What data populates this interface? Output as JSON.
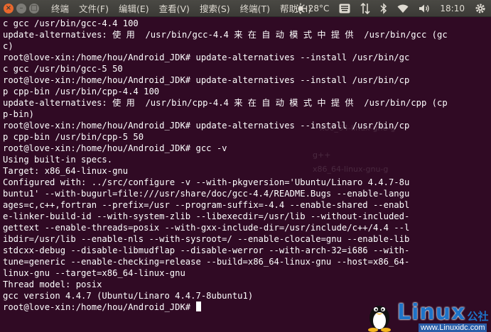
{
  "topbar": {
    "window_buttons": {
      "close": "×",
      "minimize": "–",
      "maximize": "□"
    },
    "menus": [
      "终端",
      "文件(F)",
      "编辑(E)",
      "查看(V)",
      "搜索(S)",
      "终端(T)",
      "帮助(H)"
    ],
    "indicators": {
      "weather": "28°C",
      "clock": "18:10",
      "icons": [
        "weather-sun-icon",
        "keyboard-layout-icon",
        "network-updown-icon",
        "bluetooth-icon",
        "wifi-icon",
        "volume-icon",
        "gear-icon"
      ]
    }
  },
  "terminal": {
    "lines": [
      "c gcc /usr/bin/gcc-4.4 100",
      "update-alternatives: 使 用  /usr/bin/gcc-4.4 来 在 自 动 模 式 中 提 供  /usr/bin/gcc (gc",
      "c)",
      "root@love-xin:/home/hou/Android_JDK# update-alternatives --install /usr/bin/gc",
      "c gcc /usr/bin/gcc-5 50",
      "root@love-xin:/home/hou/Android_JDK# update-alternatives --install /usr/bin/cp",
      "p cpp-bin /usr/bin/cpp-4.4 100",
      "update-alternatives: 使 用  /usr/bin/cpp-4.4 来 在 自 动 模 式 中 提 供  /usr/bin/cpp (cp",
      "p-bin)",
      "root@love-xin:/home/hou/Android_JDK# update-alternatives --install /usr/bin/cp",
      "p cpp-bin /usr/bin/cpp-5 50",
      "root@love-xin:/home/hou/Android_JDK# gcc -v",
      "Using built-in specs.",
      "Target: x86_64-linux-gnu",
      "Configured with: ../src/configure -v --with-pkgversion='Ubuntu/Linaro 4.4.7-8u",
      "buntu1' --with-bugurl=file:///usr/share/doc/gcc-4.4/README.Bugs --enable-langu",
      "ages=c,c++,fortran --prefix=/usr --program-suffix=-4.4 --enable-shared --enabl",
      "e-linker-build-id --with-system-zlib --libexecdir=/usr/lib --without-included-",
      "gettext --enable-threads=posix --with-gxx-include-dir=/usr/include/c++/4.4 --l",
      "ibdir=/usr/lib --enable-nls --with-sysroot=/ --enable-clocale=gnu --enable-lib",
      "stdcxx-debug --disable-libmudflap --disable-werror --with-arch-32=i686 --with-",
      "tune=generic --enable-checking=release --build=x86_64-linux-gnu --host=x86_64-",
      "linux-gnu --target=x86_64-linux-gnu",
      "Thread model: posix",
      "gcc version 4.4.7 (Ubuntu/Linaro 4.4.7-8ubuntu1)",
      "root@love-xin:/home/hou/Android_JDK# "
    ],
    "ghost_labels": [
      "g++",
      "x86_64-linux-gnu-g",
      "x86_64-linux-gnu-g",
      "g++"
    ]
  },
  "watermark": {
    "brand": "Linux",
    "brand_cn": "公社",
    "url": "www.Linuxidc.com"
  },
  "colors": {
    "terminal_bg": "#300a24",
    "terminal_fg": "#ffffff",
    "panel_bg": "#3c3b37",
    "panel_fg": "#dfdbd2",
    "close_button": "#e9682d",
    "watermark_blue": "#1e73c8"
  }
}
